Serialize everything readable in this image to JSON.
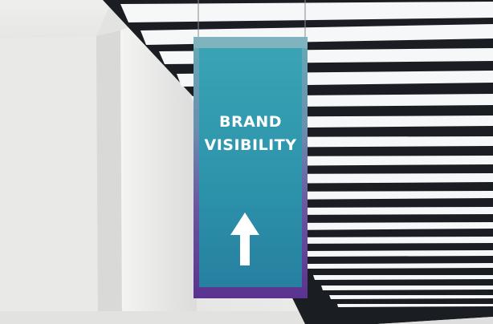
{
  "photo": {
    "subject": "hanging-banner-in-office-ceiling"
  },
  "banner": {
    "line1": "BRAND",
    "line2": "VISIBILITY",
    "arrow_icon": "arrow-up-icon",
    "colors": {
      "teal": "#2a8fa6",
      "teal_light": "#3aa3b4",
      "purple": "#6b3d9a",
      "purple_dark": "#5b3290"
    }
  },
  "ceiling": {
    "colors": {
      "slat": "#1a1d21",
      "light": "#f6f7f9"
    }
  }
}
